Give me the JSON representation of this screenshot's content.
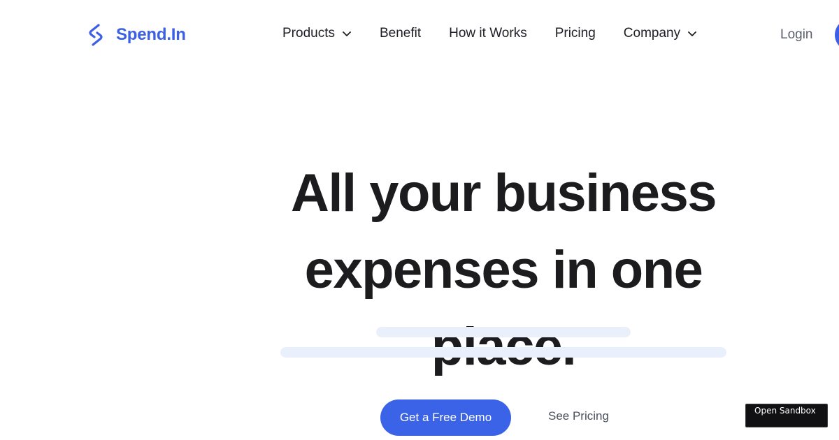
{
  "brand": {
    "name": "Spend.In",
    "logo_icon": "s-link-icon",
    "color": "#3b5fe6"
  },
  "nav": {
    "items": [
      {
        "label": "Products",
        "has_dropdown": true
      },
      {
        "label": "Benefit",
        "has_dropdown": false
      },
      {
        "label": "How it Works",
        "has_dropdown": false
      },
      {
        "label": "Pricing",
        "has_dropdown": false
      },
      {
        "label": "Company",
        "has_dropdown": true
      }
    ],
    "login_label": "Login"
  },
  "hero": {
    "title_line1": "All your business",
    "title_line2": "expenses in one",
    "title_line3": "place."
  },
  "actions": {
    "primary_label": "Get a Free Demo",
    "secondary_label": "See Pricing",
    "primary_color": "#3a63e8"
  },
  "sandbox": {
    "label": "Open Sandbox"
  }
}
